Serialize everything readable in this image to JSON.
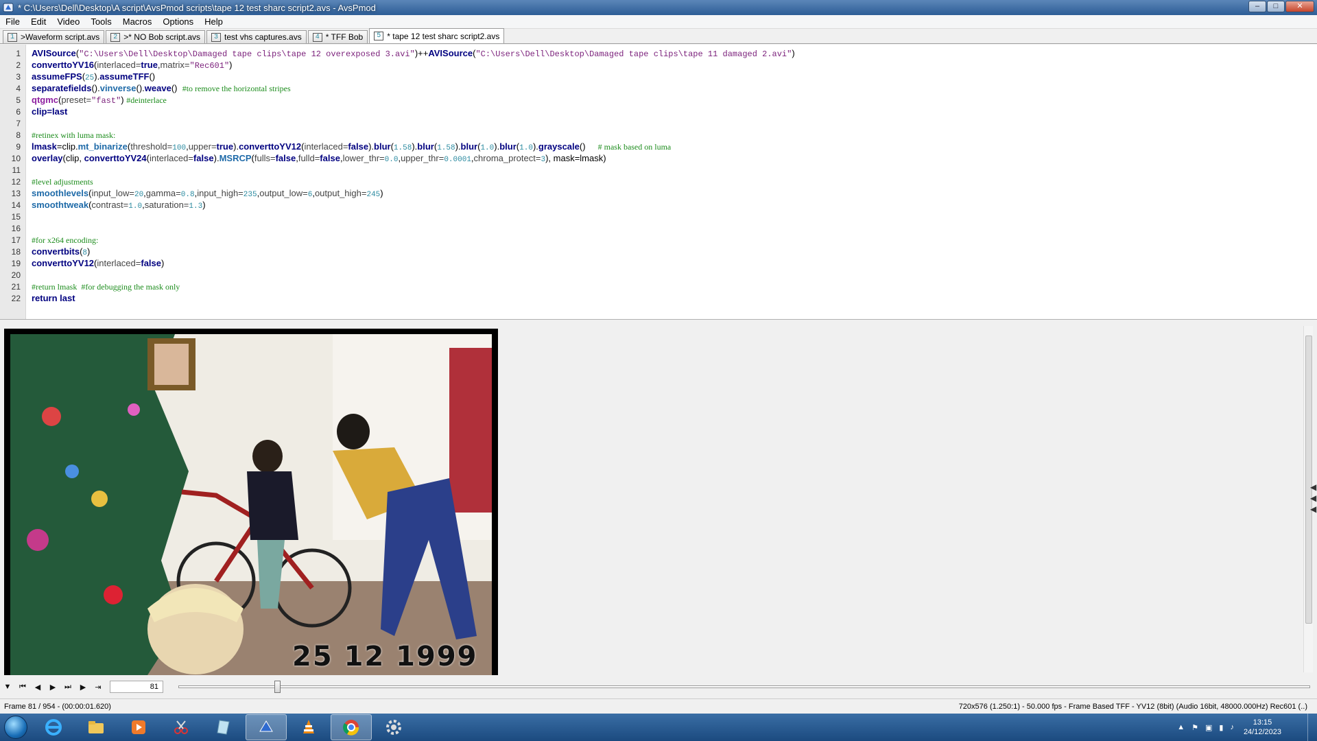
{
  "window": {
    "title": "* C:\\Users\\Dell\\Desktop\\A script\\AvsPmod scripts\\tape 12 test sharc script2.avs - AvsPmod",
    "buttons": [
      "–",
      "□",
      "✕"
    ]
  },
  "menu": [
    "File",
    "Edit",
    "Video",
    "Tools",
    "Macros",
    "Options",
    "Help"
  ],
  "tabs": [
    {
      "num": "1",
      "label": ">Waveform script.avs"
    },
    {
      "num": "2",
      "label": ">* NO Bob script.avs"
    },
    {
      "num": "3",
      "label": "test vhs captures.avs"
    },
    {
      "num": "4",
      "label": "* TFF Bob"
    },
    {
      "num": "5",
      "label": "* tape 12 test sharc script2.avs",
      "active": true
    }
  ],
  "code_lines": [
    {
      "n": "1",
      "parts": [
        [
          "fn",
          "AVISource"
        ],
        [
          "plain",
          "("
        ],
        [
          "str",
          "\"C:\\Users\\Dell\\Desktop\\Damaged tape clips\\tape 12 overexposed 3.avi\""
        ],
        [
          "plain",
          ")++"
        ],
        [
          "fn",
          "AVISource"
        ],
        [
          "plain",
          "("
        ],
        [
          "str",
          "\"C:\\Users\\Dell\\Desktop\\Damaged tape clips\\tape 11 damaged 2.avi\""
        ],
        [
          "plain",
          ")"
        ]
      ]
    },
    {
      "n": "2",
      "parts": [
        [
          "fn",
          "converttoYV16"
        ],
        [
          "plain",
          "("
        ],
        [
          "arg",
          "interlaced="
        ],
        [
          "kw",
          "true"
        ],
        [
          "plain",
          ","
        ],
        [
          "arg",
          "matrix="
        ],
        [
          "str",
          "\"Rec601\""
        ],
        [
          "plain",
          ")"
        ]
      ]
    },
    {
      "n": "3",
      "parts": [
        [
          "fn",
          "assumeFPS"
        ],
        [
          "plain",
          "("
        ],
        [
          "num",
          "25"
        ],
        [
          "plain",
          ")."
        ],
        [
          "fn",
          "assumeTFF"
        ],
        [
          "plain",
          "()"
        ]
      ]
    },
    {
      "n": "4",
      "parts": [
        [
          "fn",
          "separatefields"
        ],
        [
          "plain",
          "()."
        ],
        [
          "fn2",
          "vinverse"
        ],
        [
          "plain",
          "()."
        ],
        [
          "fn",
          "weave"
        ],
        [
          "plain",
          "()  "
        ],
        [
          "cmt",
          "#to remove the horizontal stripes"
        ]
      ]
    },
    {
      "n": "5",
      "parts": [
        [
          "fn3",
          "qtgmc"
        ],
        [
          "plain",
          "("
        ],
        [
          "arg",
          "preset="
        ],
        [
          "str",
          "\"fast\""
        ],
        [
          "plain",
          ") "
        ],
        [
          "cmt",
          "#deinterlace"
        ]
      ]
    },
    {
      "n": "6",
      "parts": [
        [
          "kw",
          "clip=last"
        ]
      ]
    },
    {
      "n": "7",
      "parts": []
    },
    {
      "n": "8",
      "parts": [
        [
          "cmt",
          "#retinex with luma mask:"
        ]
      ]
    },
    {
      "n": "9",
      "parts": [
        [
          "kw",
          "lmask"
        ],
        [
          "plain",
          "=clip."
        ],
        [
          "fn2",
          "mt_binarize"
        ],
        [
          "plain",
          "("
        ],
        [
          "arg",
          "threshold="
        ],
        [
          "num",
          "100"
        ],
        [
          "plain",
          ","
        ],
        [
          "arg",
          "upper="
        ],
        [
          "kw",
          "true"
        ],
        [
          "plain",
          ")."
        ],
        [
          "fn",
          "converttoYV12"
        ],
        [
          "plain",
          "("
        ],
        [
          "arg",
          "interlaced="
        ],
        [
          "kw",
          "false"
        ],
        [
          "plain",
          ")."
        ],
        [
          "fn",
          "blur"
        ],
        [
          "plain",
          "("
        ],
        [
          "num",
          "1.58"
        ],
        [
          "plain",
          ")."
        ],
        [
          "fn",
          "blur"
        ],
        [
          "plain",
          "("
        ],
        [
          "num",
          "1.58"
        ],
        [
          "plain",
          ")."
        ],
        [
          "fn",
          "blur"
        ],
        [
          "plain",
          "("
        ],
        [
          "num",
          "1.0"
        ],
        [
          "plain",
          ")."
        ],
        [
          "fn",
          "blur"
        ],
        [
          "plain",
          "("
        ],
        [
          "num",
          "1.0"
        ],
        [
          "plain",
          ")."
        ],
        [
          "fn",
          "grayscale"
        ],
        [
          "plain",
          "()     "
        ],
        [
          "cmt",
          "# mask based on luma"
        ]
      ]
    },
    {
      "n": "10",
      "parts": [
        [
          "fn",
          "overlay"
        ],
        [
          "plain",
          "(clip, "
        ],
        [
          "fn",
          "converttoYV24"
        ],
        [
          "plain",
          "("
        ],
        [
          "arg",
          "interlaced="
        ],
        [
          "kw",
          "false"
        ],
        [
          "plain",
          ")."
        ],
        [
          "fn2",
          "MSRCP"
        ],
        [
          "plain",
          "("
        ],
        [
          "arg",
          "fulls="
        ],
        [
          "kw",
          "false"
        ],
        [
          "plain",
          ","
        ],
        [
          "arg",
          "fulld="
        ],
        [
          "kw",
          "false"
        ],
        [
          "plain",
          ","
        ],
        [
          "arg",
          "lower_thr="
        ],
        [
          "num",
          "0.0"
        ],
        [
          "plain",
          ","
        ],
        [
          "arg",
          "upper_thr="
        ],
        [
          "num",
          "0.0001"
        ],
        [
          "plain",
          ","
        ],
        [
          "arg",
          "chroma_protect="
        ],
        [
          "num",
          "3"
        ],
        [
          "plain",
          "), mask=lmask)"
        ]
      ]
    },
    {
      "n": "11",
      "parts": []
    },
    {
      "n": "12",
      "parts": [
        [
          "cmt",
          "#level adjustments"
        ]
      ]
    },
    {
      "n": "13",
      "parts": [
        [
          "fn2",
          "smoothlevels"
        ],
        [
          "plain",
          "("
        ],
        [
          "arg",
          "input_low="
        ],
        [
          "num",
          "20"
        ],
        [
          "plain",
          ","
        ],
        [
          "arg",
          "gamma="
        ],
        [
          "num",
          "0.8"
        ],
        [
          "plain",
          ","
        ],
        [
          "arg",
          "input_high="
        ],
        [
          "num",
          "235"
        ],
        [
          "plain",
          ","
        ],
        [
          "arg",
          "output_low="
        ],
        [
          "num",
          "6"
        ],
        [
          "plain",
          ","
        ],
        [
          "arg",
          "output_high="
        ],
        [
          "num",
          "245"
        ],
        [
          "plain",
          ")"
        ]
      ]
    },
    {
      "n": "14",
      "parts": [
        [
          "fn2",
          "smoothtweak"
        ],
        [
          "plain",
          "("
        ],
        [
          "arg",
          "contrast="
        ],
        [
          "num",
          "1.0"
        ],
        [
          "plain",
          ","
        ],
        [
          "arg",
          "saturation="
        ],
        [
          "num",
          "1.3"
        ],
        [
          "plain",
          ")"
        ]
      ]
    },
    {
      "n": "15",
      "parts": []
    },
    {
      "n": "16",
      "parts": []
    },
    {
      "n": "17",
      "parts": [
        [
          "cmt",
          "#for x264 encoding:"
        ]
      ]
    },
    {
      "n": "18",
      "parts": [
        [
          "fn",
          "convertbits"
        ],
        [
          "plain",
          "("
        ],
        [
          "num",
          "8"
        ],
        [
          "plain",
          ")"
        ]
      ]
    },
    {
      "n": "19",
      "parts": [
        [
          "fn",
          "converttoYV12"
        ],
        [
          "plain",
          "("
        ],
        [
          "arg",
          "interlaced="
        ],
        [
          "kw",
          "false"
        ],
        [
          "plain",
          ")"
        ]
      ]
    },
    {
      "n": "20",
      "parts": []
    },
    {
      "n": "21",
      "parts": [
        [
          "cmt",
          "#return lmask  #for debugging the mask only"
        ]
      ]
    },
    {
      "n": "22",
      "parts": [
        [
          "kw",
          "return last"
        ]
      ]
    }
  ],
  "video": {
    "date_stamp": "25 12 1999"
  },
  "transport": {
    "frame_value": "81",
    "position": 0.085
  },
  "status": {
    "left": "Frame 81 / 954  -  (00:00:01.620)",
    "right": "720x576 (1.250:1) - 50.000 fps - Frame Based TFF - YV12 (8bit) (Audio 16bit, 48000.000Hz) Rec601 (..)"
  },
  "clock": {
    "time": "13:15",
    "date": "24/12/2023"
  },
  "colors": {
    "titlebar": "#2d5d96",
    "taskbar": "#1b4a7f",
    "comment": "#1c8c1c",
    "function": "#000080"
  }
}
